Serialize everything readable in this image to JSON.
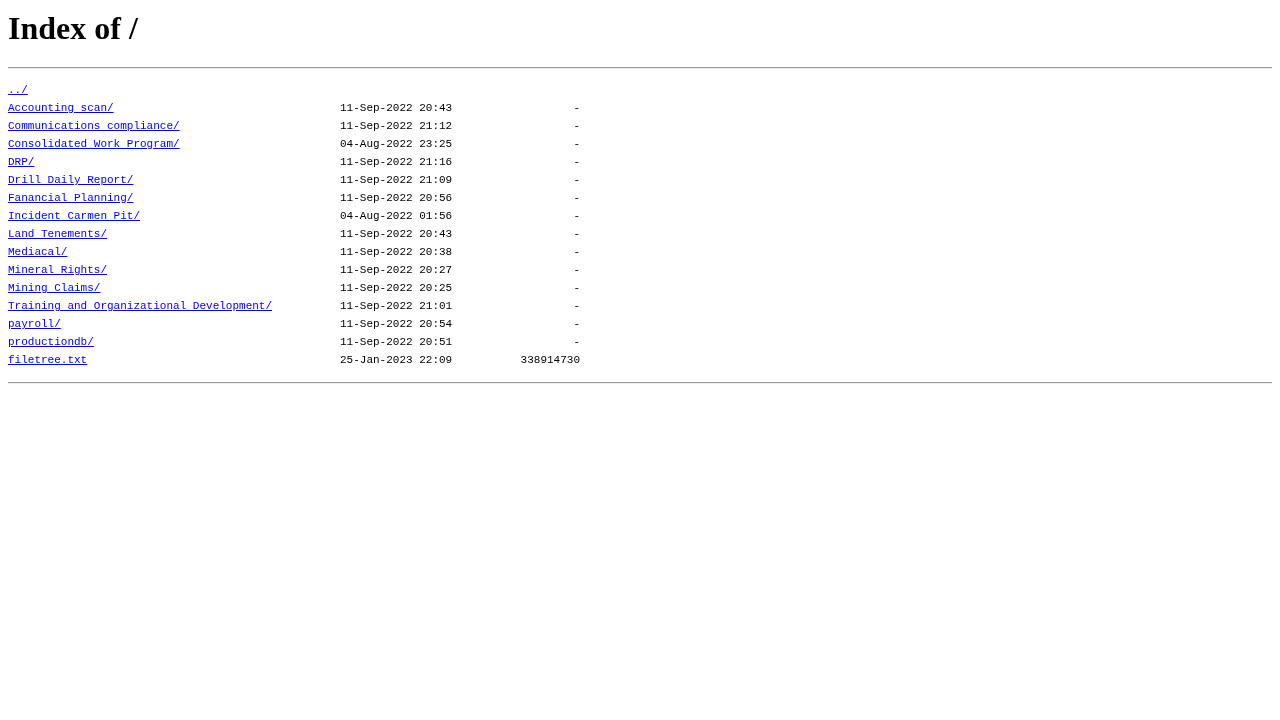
{
  "title": "Index of /",
  "parent_link": "../",
  "entries": [
    {
      "name": "Accounting scan/",
      "modified": "11-Sep-2022 20:43",
      "size": "-"
    },
    {
      "name": "Communications compliance/",
      "modified": "11-Sep-2022 21:12",
      "size": "-"
    },
    {
      "name": "Consolidated Work Program/",
      "modified": "04-Aug-2022 23:25",
      "size": "-"
    },
    {
      "name": "DRP/",
      "modified": "11-Sep-2022 21:16",
      "size": "-"
    },
    {
      "name": "Drill Daily Report/",
      "modified": "11-Sep-2022 21:09",
      "size": "-"
    },
    {
      "name": "Fanancial Planning/",
      "modified": "11-Sep-2022 20:56",
      "size": "-"
    },
    {
      "name": "Incident Carmen Pit/",
      "modified": "04-Aug-2022 01:56",
      "size": "-"
    },
    {
      "name": "Land Tenements/",
      "modified": "11-Sep-2022 20:43",
      "size": "-"
    },
    {
      "name": "Mediacal/",
      "modified": "11-Sep-2022 20:38",
      "size": "-"
    },
    {
      "name": "Mineral Rights/",
      "modified": "11-Sep-2022 20:27",
      "size": "-"
    },
    {
      "name": "Mining Claims/",
      "modified": "11-Sep-2022 20:25",
      "size": "-"
    },
    {
      "name": "Training and Organizational Development/",
      "modified": "11-Sep-2022 21:01",
      "size": "-"
    },
    {
      "name": "payroll/",
      "modified": "11-Sep-2022 20:54",
      "size": "-"
    },
    {
      "name": "productiondb/",
      "modified": "11-Sep-2022 20:51",
      "size": "-"
    },
    {
      "name": "filetree.txt",
      "modified": "25-Jan-2023 22:09",
      "size": "338914730"
    }
  ]
}
